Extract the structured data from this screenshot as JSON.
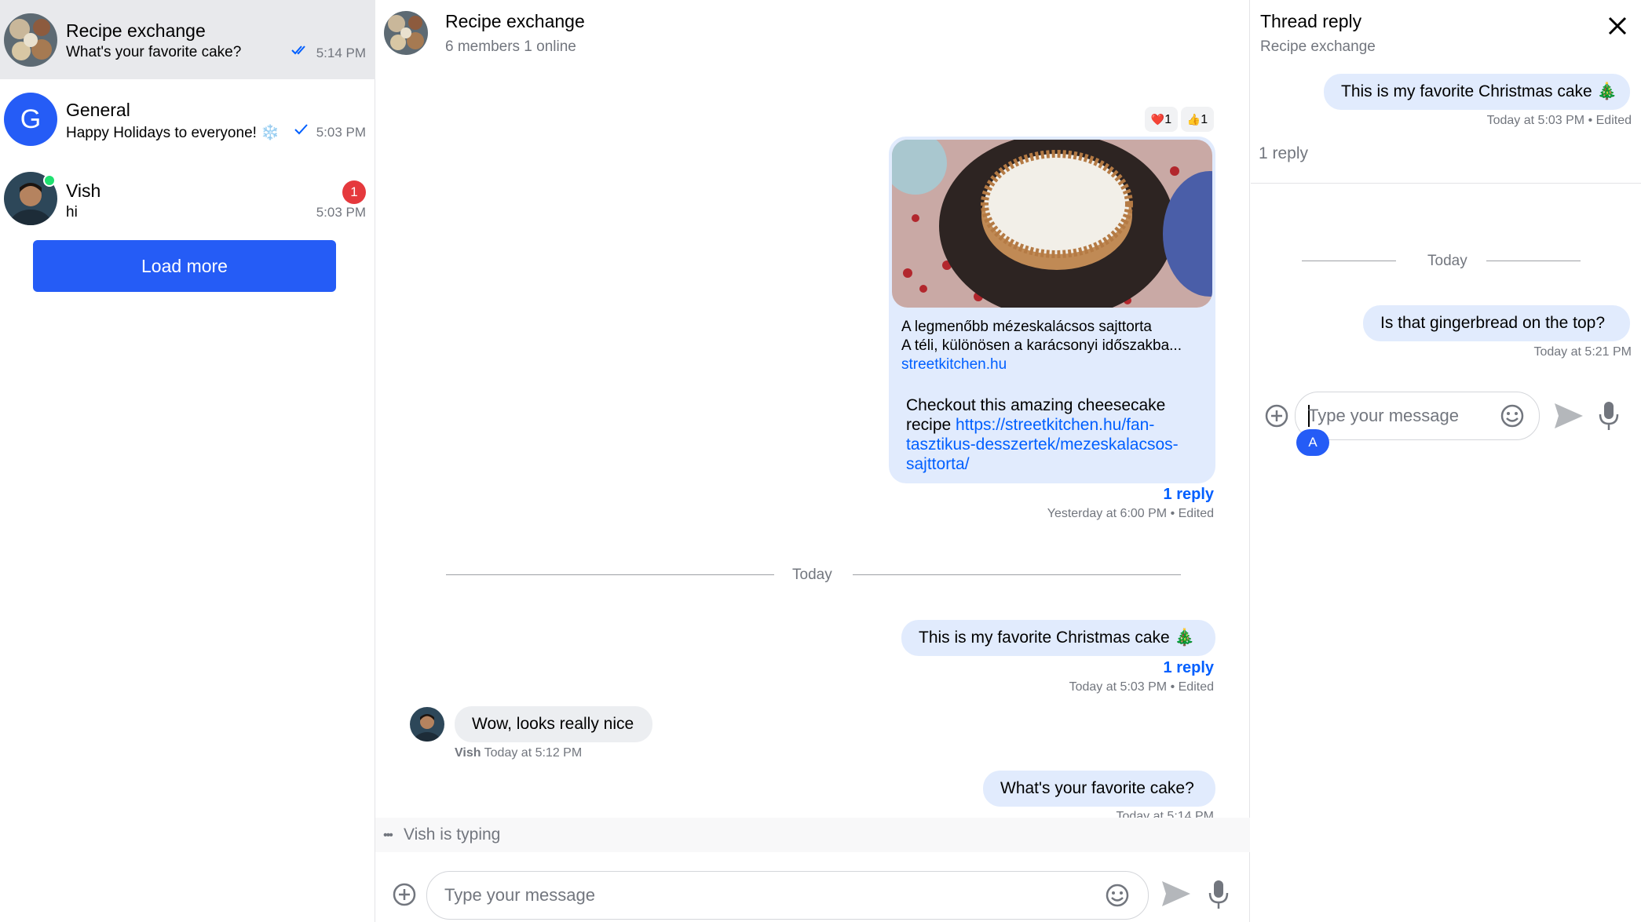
{
  "sidebar": {
    "channels": [
      {
        "name": "Recipe exchange",
        "preview": "What's your favorite cake?",
        "time": "5:14 PM",
        "status": "read"
      },
      {
        "name": "General",
        "avatar_letter": "G",
        "preview": "Happy Holidays to everyone! ❄️",
        "time": "5:03 PM",
        "status": "sent"
      },
      {
        "name": "Vish",
        "preview": "hi",
        "time": "5:03 PM",
        "unread": "1"
      }
    ],
    "load_more_label": "Load more"
  },
  "main": {
    "header": {
      "title": "Recipe exchange",
      "subtitle": "6 members 1 online"
    },
    "reactions": [
      {
        "emoji": "❤️",
        "count": "1"
      },
      {
        "emoji": "👍",
        "count": "1"
      }
    ],
    "link_message": {
      "preview_title": "A legmenőbb mézeskalácsos sajttorta",
      "preview_desc": "A téli, különösen a karácsonyi időszakba...",
      "preview_domain": "streetkitchen.hu",
      "text_before": "Checkout this amazing cheesecake recipe ",
      "link_line1": "https://streetkitchen.hu/fan-",
      "link_line2": "tasztikus-desszertek/mezeskalacsos-",
      "link_line3": "sajttorta/",
      "reply_label": "1 reply",
      "timestamp": "Yesterday at 6:00 PM",
      "edited": "Edited"
    },
    "date_separator": "Today",
    "messages": [
      {
        "text": "This is my favorite Christmas cake 🎄",
        "reply_label": "1 reply",
        "timestamp": "Today at 5:03 PM",
        "edited": "Edited"
      },
      {
        "author": "Vish",
        "text": "Wow, looks really nice",
        "timestamp": "Today at 5:12 PM"
      },
      {
        "text": "What's your favorite cake?",
        "timestamp": "Today at 5:14 PM"
      }
    ],
    "typing_indicator": "Vish is typing",
    "composer_placeholder": "Type your message"
  },
  "thread": {
    "title": "Thread reply",
    "subtitle": "Recipe exchange",
    "parent": {
      "text": "This is my favorite Christmas cake 🎄",
      "timestamp": "Today at 5:03 PM",
      "edited": "Edited"
    },
    "reply_count": "1 reply",
    "date_separator": "Today",
    "reply": {
      "text": "Is that gingerbread on the top?",
      "timestamp": "Today at 5:21 PM"
    },
    "composer_placeholder": "Type your message",
    "user_initial": "A"
  },
  "colors": {
    "accent": "#005fff",
    "load_more_bg": "#255cf6",
    "my_bubble": "#e1ebfd",
    "other_bubble": "#eceef1",
    "unread_badge": "#e5393d",
    "online_dot": "#20e070"
  }
}
